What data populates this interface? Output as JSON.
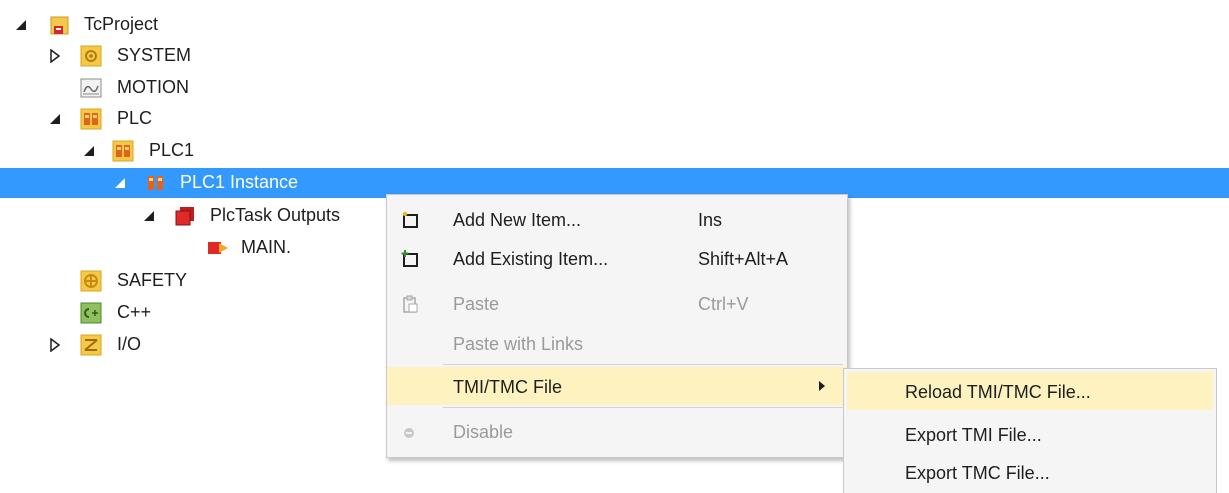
{
  "tree": {
    "items": [
      {
        "label": "TcProject",
        "icon": "project-icon",
        "expander": "expanded"
      },
      {
        "label": "SYSTEM",
        "icon": "system-icon",
        "expander": "collapsed"
      },
      {
        "label": "MOTION",
        "icon": "motion-icon",
        "expander": "none"
      },
      {
        "label": "PLC",
        "icon": "plc-icon",
        "expander": "expanded"
      },
      {
        "label": "PLC1",
        "icon": "plc-project-icon",
        "expander": "expanded"
      },
      {
        "label": "PLC1 Instance",
        "icon": "plc-instance-icon",
        "expander": "expanded",
        "selected": true
      },
      {
        "label": "PlcTask Outputs",
        "icon": "plctask-outputs-icon",
        "expander": "expanded"
      },
      {
        "label": "MAIN.",
        "icon": "output-variable-icon",
        "expander": "none"
      },
      {
        "label": "SAFETY",
        "icon": "safety-icon",
        "expander": "none"
      },
      {
        "label": "C++",
        "icon": "cpp-icon",
        "expander": "none"
      },
      {
        "label": "I/O",
        "icon": "io-icon",
        "expander": "collapsed"
      }
    ]
  },
  "context_menu": {
    "items": [
      {
        "label": "Add New Item...",
        "shortcut": "Ins",
        "icon": "add-new-item-icon"
      },
      {
        "label": "Add Existing Item...",
        "shortcut": "Shift+Alt+A",
        "icon": "add-existing-item-icon"
      },
      {
        "label": "Paste",
        "shortcut": "Ctrl+V",
        "icon": "paste-icon",
        "disabled": true
      },
      {
        "label": "Paste with Links",
        "shortcut": "",
        "disabled": true
      },
      {
        "label": "TMI/TMC File",
        "shortcut": "",
        "submenu": true,
        "highlighted": true
      },
      {
        "label": "Disable",
        "shortcut": "",
        "icon": "disable-icon",
        "disabled": true
      }
    ]
  },
  "submenu": {
    "items": [
      {
        "label": "Reload TMI/TMC File...",
        "highlighted": true
      },
      {
        "label": "Export TMI File..."
      },
      {
        "label": "Export TMC File..."
      }
    ]
  },
  "colors": {
    "selection": "#3399ff",
    "menu_highlight": "#fef3c0",
    "menu_background": "#f5f5f5",
    "disabled_text": "#9a9a9a"
  }
}
